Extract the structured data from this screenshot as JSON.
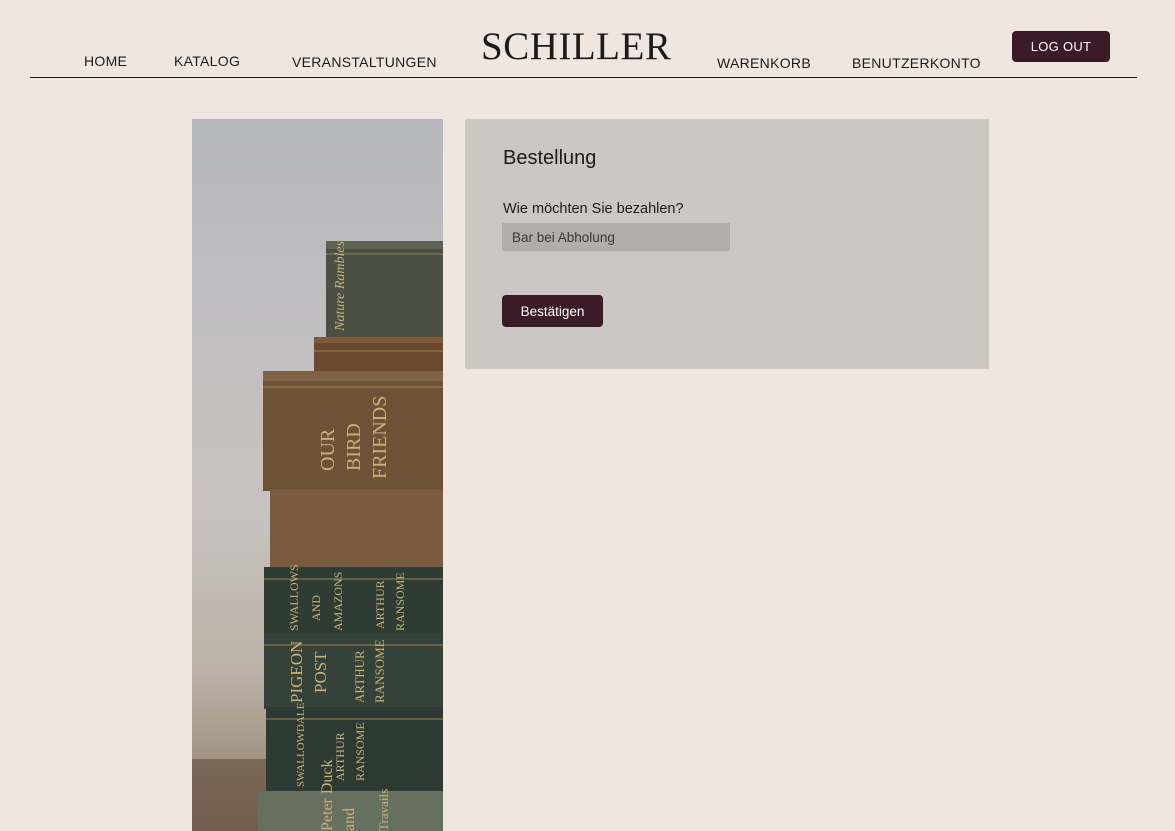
{
  "header": {
    "brand": "SCHILLER",
    "nav": {
      "home": "HOME",
      "katalog": "KATALOG",
      "veranstaltungen": "VERANSTALTUNGEN",
      "warenkorb": "WARENKORB",
      "benutzerkonto": "BENUTZERKONTO"
    },
    "logout_label": "LOG OUT"
  },
  "order": {
    "title": "Bestellung",
    "payment_question": "Wie möchten Sie bezahlen?",
    "payment_selected": "Bar bei Abholung",
    "confirm_label": "Bestätigen"
  },
  "image": {
    "subject": "stack-of-books-photo",
    "spine_texts": {
      "book1": "Nature Rambles",
      "book3a": "OUR",
      "book3b": "BIRD",
      "book3c": "FRIENDS",
      "book5a": "SWALLOWS",
      "book5b": "AND",
      "book5c": "AMAZONS",
      "book5d": "ARTHUR",
      "book5e": "RANSOME",
      "book6a": "PIGEON",
      "book6b": "POST",
      "book6c": "ARTHUR",
      "book6d": "RANSOME",
      "book7a": "SWALLOWDALE",
      "book7b": "ARTHUR",
      "book7c": "RANSOME",
      "book8a": "Peter Duck",
      "book8b": "and",
      "book8c": "Travails"
    }
  },
  "colors": {
    "background": "#efe7df",
    "accent": "#3a1b27",
    "panel": "#cbc8c2",
    "select": "#b1aeaa"
  }
}
